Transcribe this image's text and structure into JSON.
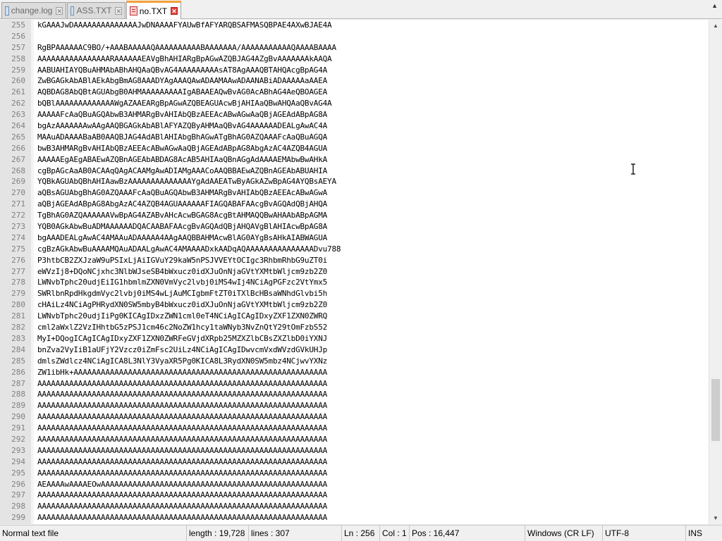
{
  "tabs": [
    {
      "label": "change.log",
      "active": false
    },
    {
      "label": "ASS.TXT",
      "active": false
    },
    {
      "label": "no.TXT",
      "active": true
    }
  ],
  "editor": {
    "current_line": 256,
    "lines": [
      {
        "num": "255",
        "text": "kGAAAJwDAAAAAAAAAAAAAAJwDNAAAAFYAUwBfAFYARQBSAFMASQBPAE4AXwBJAE4A"
      },
      {
        "num": "256",
        "text": ""
      },
      {
        "num": "257",
        "text": "RgBPAAAAAAC9BO/+AAABAAAAAQAAAAAAAAAABAAAAAAA/AAAAAAAAAAAQAAAABAAAA"
      },
      {
        "num": "258",
        "text": "AAAAAAAAAAAAAAAARAAAAAAEAVgBhAHIARgBpAGwAZQBJAG4AZgBvAAAAAAAkAAQA"
      },
      {
        "num": "259",
        "text": "AABUAHIAYQBuAHMAbABhAHQAaQBvAG4AAAAAAAAAsAT8AgAAAQBTAHQAcgBpAG4A"
      },
      {
        "num": "260",
        "text": "ZwBGAGkAbABlAEkAbgBmAG8AAADYAgAAAQAwADAAMAAwADAANABiADAAAAAaAAEA"
      },
      {
        "num": "261",
        "text": "AQBDAG8AbQBtAGUAbgB0AHMAAAAAAAAAIgABAAEAQwBvAG0AcABhAG4AeQBOAGEA"
      },
      {
        "num": "262",
        "text": "bQBlAAAAAAAAAAAAAWgAZAAEARgBpAGwAZQBEAGUAcwBjAHIAaQBwAHQAaQBvAG4A"
      },
      {
        "num": "263",
        "text": "AAAAAFcAaQBuAGQAbwB3AHMARgBvAHIAbQBzAEEAcABwAGwAaQBjAGEAdABpAG8A"
      },
      {
        "num": "264",
        "text": "bgAzAAAAAAAwAAgAAQBGAGkAbABlAFYAZQByAHMAaQBvAG4AAAAAADEALgAwAC4A"
      },
      {
        "num": "265",
        "text": "MAAuADAAAABaAB0AAQBJAG4AdABlAHIAbgBhAGwATgBhAG0AZQAAAFcAaQBuAGQA"
      },
      {
        "num": "266",
        "text": "bwB3AHMARgBvAHIAbQBzAEEAcABwAGwAaQBjAGEAdABpAG8AbgAzAC4AZQB4AGUA"
      },
      {
        "num": "267",
        "text": "AAAAAEgAEgABAEwAZQBnAGEAbABDAG8AcAB5AHIAaQBnAGgAdAAAAEMAbwBwAHkA"
      },
      {
        "num": "268",
        "text": "cgBpAGcAaAB0ACAAqQAgACAAMgAwADIAMgAAACoAAQBBAEwAZQBnAGEAbABUAHIA"
      },
      {
        "num": "269",
        "text": "YQBkAGUAbQBhAHIAawBzAAAAAAAAAAAAAAYgAdAAEATwByAGkAZwBpAG4AYQBsAEYA"
      },
      {
        "num": "270",
        "text": "aQBsAGUAbgBhAG0AZQAAAFcAaQBuAGQAbwB3AHMARgBvAHIAbQBzAEEAcABwAGwA"
      },
      {
        "num": "271",
        "text": "aQBjAGEAdABpAG8AbgAzAC4AZQB4AGUAAAAAAFIAGQABAFAAcgBvAGQAdQBjAHQA"
      },
      {
        "num": "272",
        "text": "TgBhAG0AZQAAAAAAVwBpAG4AZABvAHcAcwBGAG8AcgBtAHMAQQBwAHAAbABpAGMA"
      },
      {
        "num": "273",
        "text": "YQB0AGkAbwBuADMAAAAAADQACAABAFAAcgBvAGQAdQBjAHQAVgBlAHIAcwBpAG8A"
      },
      {
        "num": "274",
        "text": "bgAAADEALgAwAC4AMAAuADAAAAA4AAgAAQBBAHMAcwBlAG0AYgBsAHkAIABWAGUA"
      },
      {
        "num": "275",
        "text": "cgBzAGkAbwBuAAAAMQAuADAALgAwAC4AMAAAADxkAADqAQAAAAAAAAAAAAAAADvu788"
      },
      {
        "num": "276",
        "text": "P3htbCB2ZXJzaW9uPSIxLjAiIGVuY29kaW5nPSJVVEYtOCIgc3RhbmRhbG9uZT0i"
      },
      {
        "num": "277",
        "text": "eWVzIj8+DQoNCjxhc3NlbWJseSB4bWxucz0idXJuOnNjaGVtYXMtbWljcm9zb2Z0"
      },
      {
        "num": "278",
        "text": "LWNvbTphc20udjEiIG1hbmlmZXN0VmVyc2lvbj0iMS4wIj4NCiAgPGFzc2VtYmx5"
      },
      {
        "num": "279",
        "text": "SWRlbnRpdHkgdmVyc2lvbj0iMS4wLjAuMCIgbmFtZT0iTXlBcHBsaWNhdGlvbi5h"
      },
      {
        "num": "280",
        "text": "cHAiLz4NCiAgPHRydXN0SW5mbyB4bWxucz0idXJuOnNjaGVtYXMtbWljcm9zb2Z0"
      },
      {
        "num": "281",
        "text": "LWNvbTphc20udjIiPg0KICAgIDxzZWN1cml0eT4NCiAgICAgIDxyZXF1ZXN0ZWRQ"
      },
      {
        "num": "282",
        "text": "cml2aWxlZ2VzIHhtbG5zPSJ1cm46c2NoZW1hcy1taWNyb3NvZnQtY29tOmFzbS52"
      },
      {
        "num": "283",
        "text": "MyI+DQogICAgICAgIDxyZXF1ZXN0ZWRFeGVjdXRpb25MZXZlbCBsZXZlbD0iYXNJ"
      },
      {
        "num": "284",
        "text": "bnZva2VyIiB1aUFjY2Vzcz0iZmFsc2UiLz4NCiAgICAgIDwvcmVxdWVzdGVkUHJp"
      },
      {
        "num": "285",
        "text": "dmlsZWdlcz4NCiAgICA8L3NlY3VyaXR5Pg0KICA8L3RydXN0SW5mbz4NCjwvYXNz"
      },
      {
        "num": "286",
        "text": "ZW1ibHk+AAAAAAAAAAAAAAAAAAAAAAAAAAAAAAAAAAAAAAAAAAAAAAAAAAAAAAAA"
      },
      {
        "num": "287",
        "text": "AAAAAAAAAAAAAAAAAAAAAAAAAAAAAAAAAAAAAAAAAAAAAAAAAAAAAAAAAAAAAAAA"
      },
      {
        "num": "288",
        "text": "AAAAAAAAAAAAAAAAAAAAAAAAAAAAAAAAAAAAAAAAAAAAAAAAAAAAAAAAAAAAAAAA"
      },
      {
        "num": "289",
        "text": "AAAAAAAAAAAAAAAAAAAAAAAAAAAAAAAAAAAAAAAAAAAAAAAAAAAAAAAAAAAAAAAA"
      },
      {
        "num": "290",
        "text": "AAAAAAAAAAAAAAAAAAAAAAAAAAAAAAAAAAAAAAAAAAAAAAAAAAAAAAAAAAAAAAAA"
      },
      {
        "num": "291",
        "text": "AAAAAAAAAAAAAAAAAAAAAAAAAAAAAAAAAAAAAAAAAAAAAAAAAAAAAAAAAAAAAAAA"
      },
      {
        "num": "292",
        "text": "AAAAAAAAAAAAAAAAAAAAAAAAAAAAAAAAAAAAAAAAAAAAAAAAAAAAAAAAAAAAAAAA"
      },
      {
        "num": "293",
        "text": "AAAAAAAAAAAAAAAAAAAAAAAAAAAAAAAAAAAAAAAAAAAAAAAAAAAAAAAAAAAAAAAA"
      },
      {
        "num": "294",
        "text": "AAAAAAAAAAAAAAAAAAAAAAAAAAAAAAAAAAAAAAAAAAAAAAAAAAAAAAAAAAAAAAAA"
      },
      {
        "num": "295",
        "text": "AAAAAAAAAAAAAAAAAAAAAAAAAAAAAAAAAAAAAAAAAAAAAAAAAAAAAAAAAAAAAAAA"
      },
      {
        "num": "296",
        "text": "AEAAAAwAAAAEOwAAAAAAAAAAAAAAAAAAAAAAAAAAAAAAAAAAAAAAAAAAAAAAAAAA"
      },
      {
        "num": "297",
        "text": "AAAAAAAAAAAAAAAAAAAAAAAAAAAAAAAAAAAAAAAAAAAAAAAAAAAAAAAAAAAAAAAA"
      },
      {
        "num": "298",
        "text": "AAAAAAAAAAAAAAAAAAAAAAAAAAAAAAAAAAAAAAAAAAAAAAAAAAAAAAAAAAAAAAAA"
      },
      {
        "num": "299",
        "text": "AAAAAAAAAAAAAAAAAAAAAAAAAAAAAAAAAAAAAAAAAAAAAAAAAAAAAAAAAAAAAAAA"
      }
    ]
  },
  "scrollbar": {
    "up_icon": "triangle-up",
    "down_icon": "triangle-down",
    "up_glyph": "▲",
    "down_glyph": "▼"
  },
  "tab_scroll_glyph": "▲",
  "statusbar": {
    "file_type": "Normal text file",
    "length": "length : 19,728",
    "lines": "lines : 307",
    "ln": "Ln : 256",
    "col": "Col : 1",
    "pos": "Pos : 16,447",
    "eol": "Windows (CR LF)",
    "encoding": "UTF-8",
    "mode": "INS"
  },
  "colors": {
    "active_tab_accent": "#f3a03a",
    "current_line_bg": "#e8e8ff",
    "gutter_bg": "#e4e4e4"
  }
}
